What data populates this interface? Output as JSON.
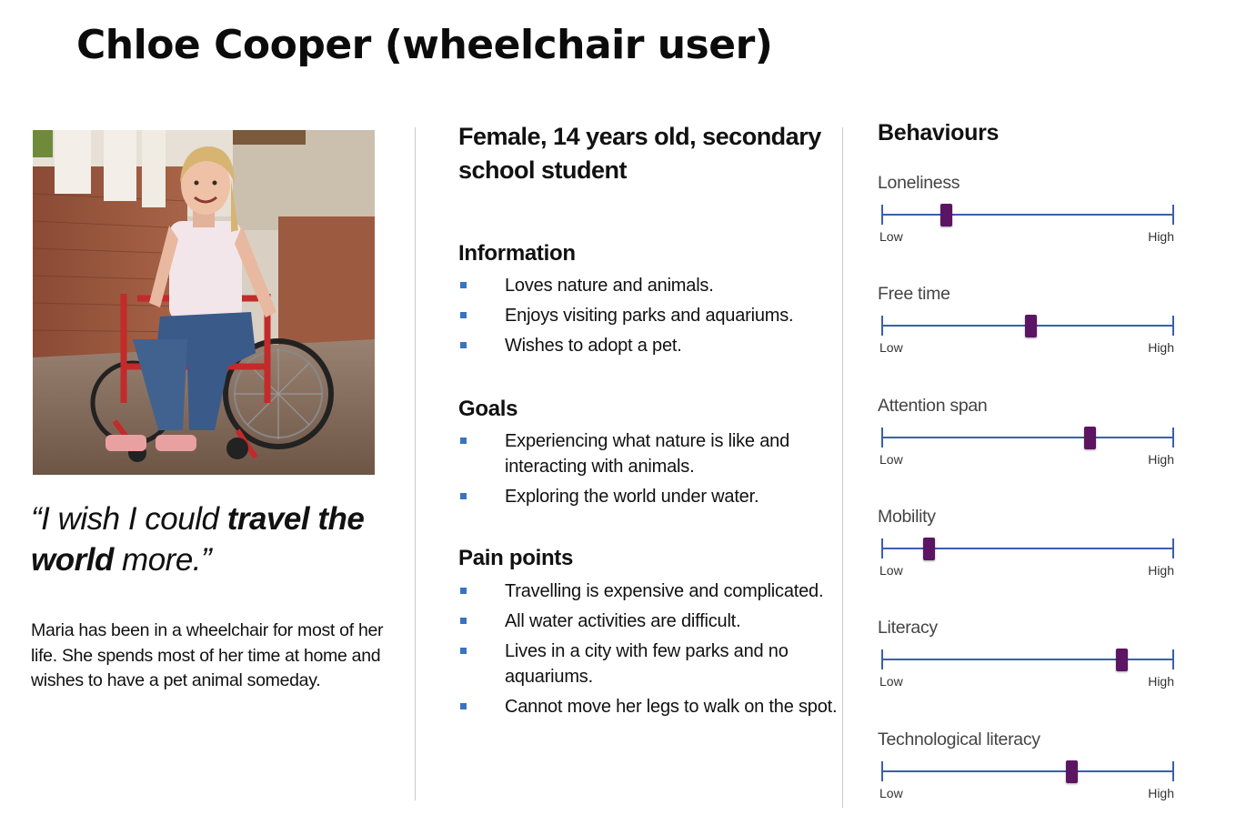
{
  "persona": {
    "title": "Chloe Cooper (wheelchair user)",
    "quote_part1": "“I wish I could ",
    "quote_bold1": "travel the world",
    "quote_part2": " more.”",
    "bio": "Maria has been in a wheelchair for most of her life. She spends most of her time at home and wishes to have a pet animal someday."
  },
  "demographics": "Female, 14 years old, secondary school student",
  "sections": {
    "information": {
      "heading": "Information",
      "items": [
        "Loves nature and animals.",
        "Enjoys visiting parks and aquariums.",
        "Wishes to adopt a pet."
      ]
    },
    "goals": {
      "heading": "Goals",
      "items": [
        "Experiencing what nature is like and interacting with animals.",
        "Exploring the world under water."
      ]
    },
    "pain_points": {
      "heading": "Pain points",
      "items": [
        "Travelling is expensive and complicated.",
        "All water activities are difficult.",
        "Lives in a city with few parks and no aquariums.",
        "Cannot move her legs to walk on the spot."
      ]
    }
  },
  "behaviours": {
    "heading": "Behaviours",
    "low_label": "Low",
    "high_label": "High",
    "thumb_color": "#5c1562",
    "track_color": "#3a5fb0",
    "items": [
      {
        "label": "Loneliness",
        "level": 0.22
      },
      {
        "label": "Free time",
        "level": 0.51
      },
      {
        "label": "Attention span",
        "level": 0.71
      },
      {
        "label": "Mobility",
        "level": 0.16
      },
      {
        "label": "Literacy",
        "level": 0.82
      },
      {
        "label": "Technological literacy",
        "level": 0.65
      }
    ]
  }
}
